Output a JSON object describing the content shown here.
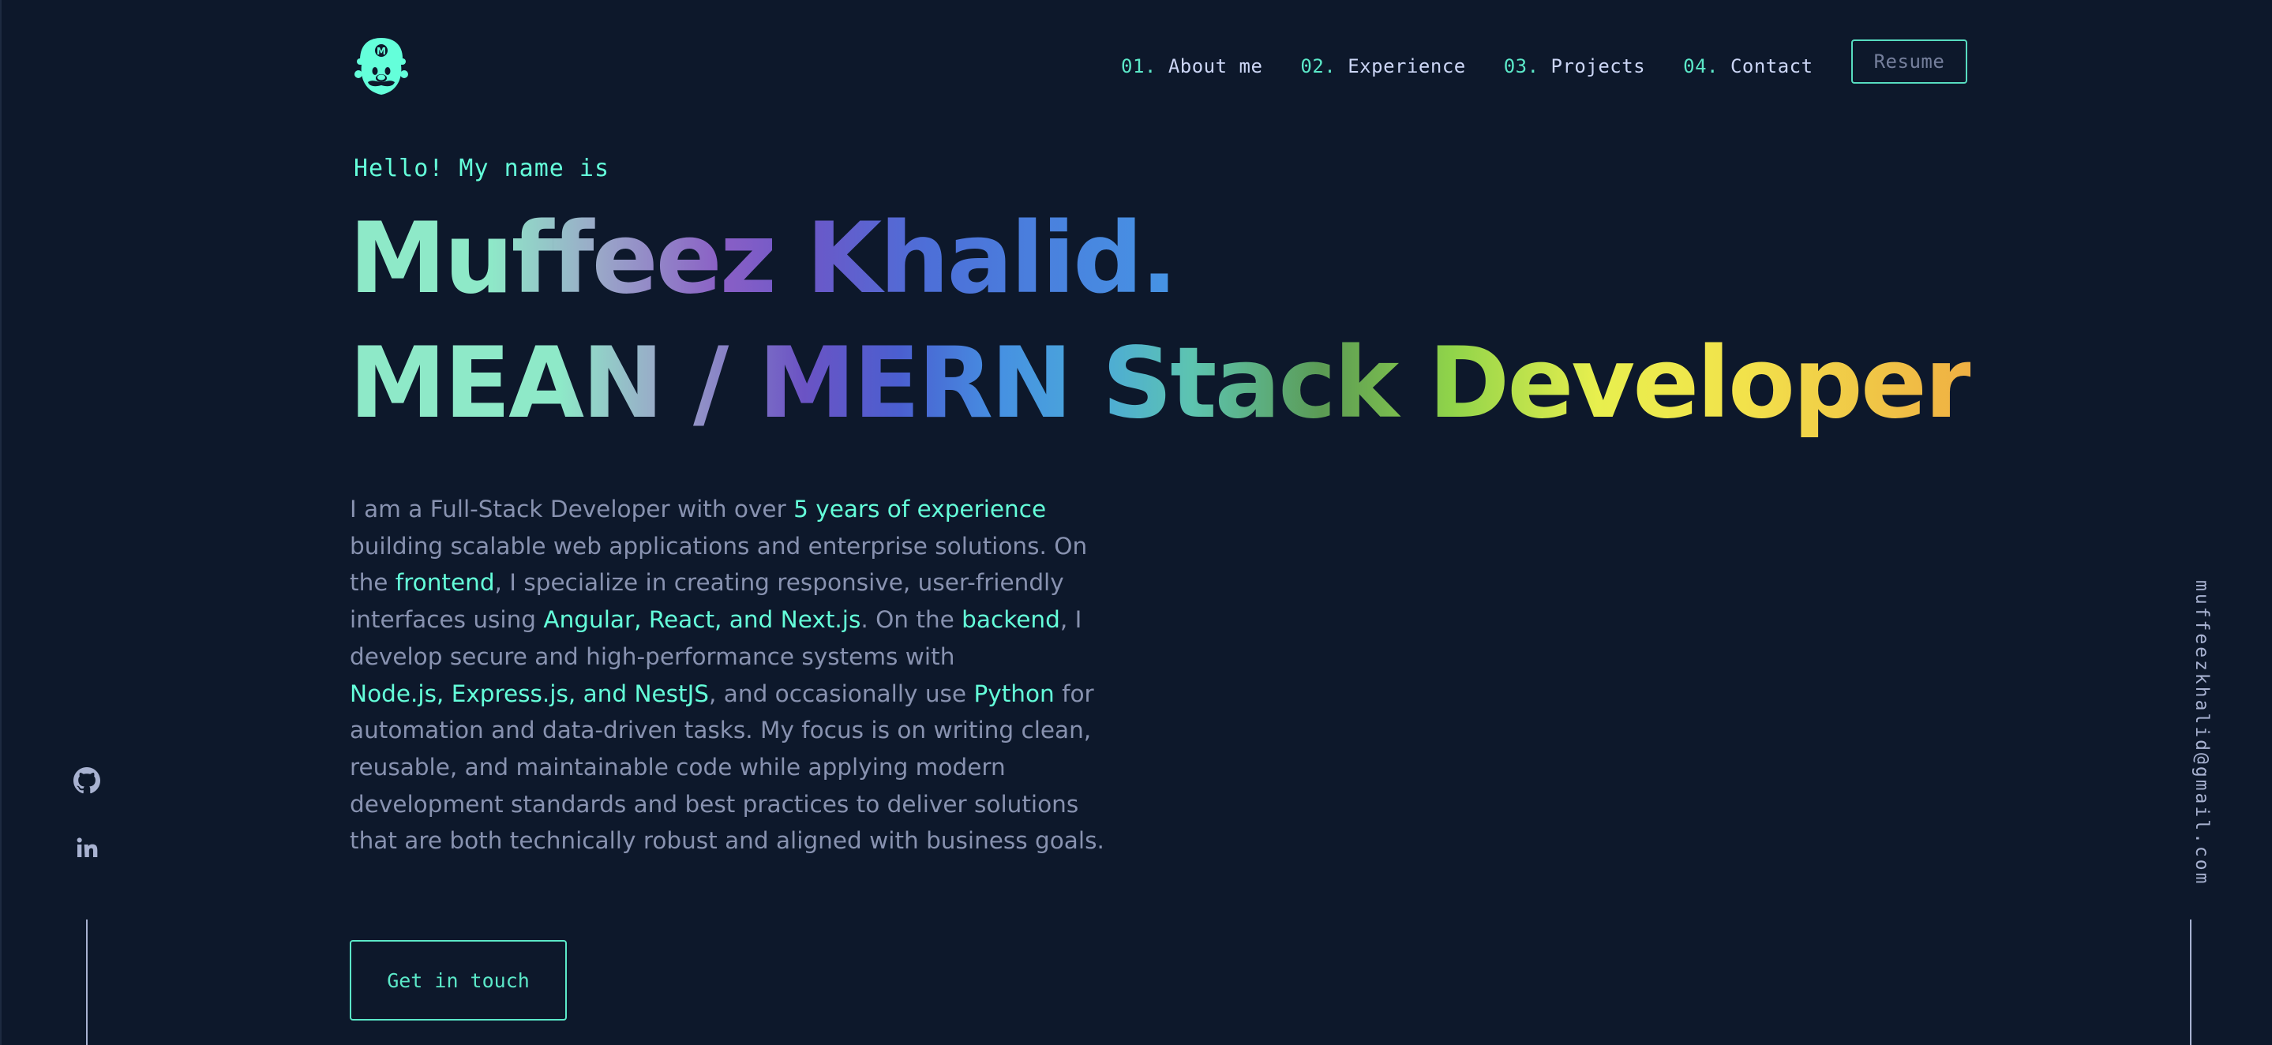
{
  "colors": {
    "background": "#0d182b",
    "accent": "#64ffda",
    "text_muted": "#8892b0",
    "text_light": "#ccd6f6"
  },
  "header": {
    "logo_icon": "mario-face-icon",
    "nav": [
      {
        "num": "01.",
        "label": "About me"
      },
      {
        "num": "02.",
        "label": "Experience"
      },
      {
        "num": "03.",
        "label": "Projects"
      },
      {
        "num": "04.",
        "label": "Contact"
      }
    ],
    "resume_label": "Resume"
  },
  "hero": {
    "greeting": "Hello! My name is",
    "name": "Muffeez Khalid.",
    "role": "MEAN / MERN Stack Developer",
    "description": {
      "lines": [
        [
          {
            "t": "I am a Full-Stack Developer with over "
          },
          {
            "t": "5 years of experience",
            "hl": true
          }
        ],
        [
          {
            "t": "building scalable web applications and enterprise solutions. On"
          }
        ],
        [
          {
            "t": "the "
          },
          {
            "t": "frontend",
            "hl": true
          },
          {
            "t": ", I specialize in creating responsive, user-friendly"
          }
        ],
        [
          {
            "t": "interfaces using "
          },
          {
            "t": "Angular, React, and Next.js",
            "hl": true
          },
          {
            "t": ". On the "
          },
          {
            "t": "backend",
            "hl": true
          },
          {
            "t": ", I"
          }
        ],
        [
          {
            "t": "develop secure and high-performance systems with"
          }
        ],
        [
          {
            "t": "Node.js, Express.js, and NestJS",
            "hl": true
          },
          {
            "t": ", and occasionally use "
          },
          {
            "t": "Python",
            "hl": true
          },
          {
            "t": " for"
          }
        ],
        [
          {
            "t": "automation and data-driven tasks. My focus is on writing clean,"
          }
        ],
        [
          {
            "t": "reusable, and maintainable code while applying modern"
          }
        ],
        [
          {
            "t": "development standards and best practices to deliver solutions"
          }
        ],
        [
          {
            "t": "that are both technically robust and aligned with business goals."
          }
        ]
      ]
    },
    "cta_label": "Get in touch"
  },
  "social": {
    "items": [
      "github-icon",
      "linkedin-icon"
    ]
  },
  "email": "muffeezkhalid@gmail.com"
}
